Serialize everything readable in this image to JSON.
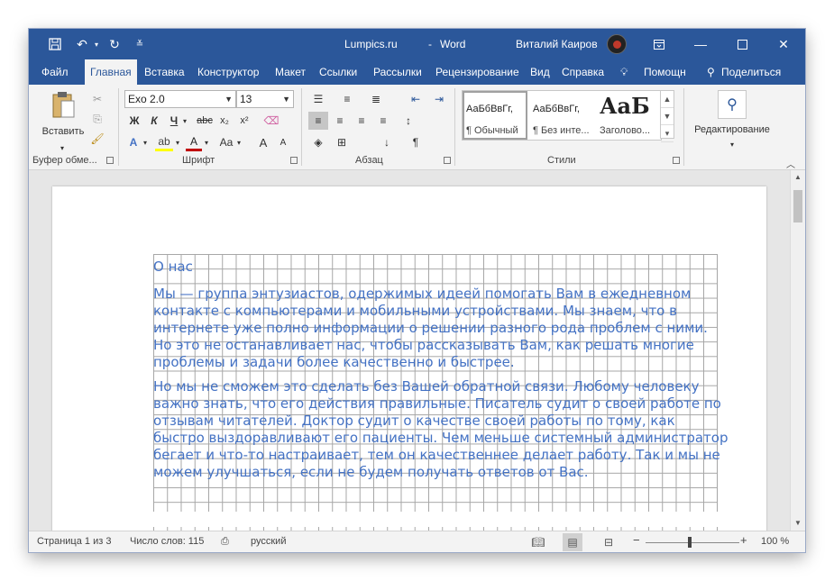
{
  "window": {
    "doc_title": "Lumpics.ru",
    "separator": "-",
    "app_name": "Word",
    "user_name": "Виталий Каиров"
  },
  "quick_access": {
    "save_icon": "save-icon",
    "undo_icon": "undo-icon",
    "redo_icon": "redo-icon",
    "customize_icon": "customize-icon"
  },
  "tabs": [
    "Файл",
    "Главная",
    "Вставка",
    "Конструктор",
    "Макет",
    "Ссылки",
    "Рассылки",
    "Рецензирование",
    "Вид",
    "Справка",
    "Помощн",
    "Поделиться"
  ],
  "active_tab": "Главная",
  "ribbon": {
    "clipboard": {
      "paste_label": "Вставить",
      "group_label": "Буфер обме..."
    },
    "font": {
      "font_name": "Exo 2.0",
      "font_size": "13",
      "group_label": "Шрифт",
      "bold": "Ж",
      "italic": "К",
      "underline": "Ч",
      "strike": "abc",
      "sub": "x₂",
      "sup": "x²",
      "case": "Aa",
      "grow": "A",
      "shrink": "A"
    },
    "paragraph": {
      "group_label": "Абзац"
    },
    "styles": {
      "group_label": "Стили",
      "items": [
        {
          "sample": "АаБбВвГг,",
          "name": "¶ Обычный"
        },
        {
          "sample": "АаБбВвГг,",
          "name": "¶ Без инте..."
        },
        {
          "sample": "АаБ",
          "name": "Заголово..."
        }
      ]
    },
    "editing": {
      "label": "Редактирование"
    }
  },
  "document": {
    "heading": "О нас",
    "paragraphs": [
      "Мы — группа энтузиастов, одержимых идеей помогать Вам в ежедневном контакте с компьютерами и мобильными устройствами. Мы знаем, что в интернете уже полно информации о решении разного рода проблем с ними. Но это не останавливает нас, чтобы рассказывать Вам, как решать многие проблемы и задачи более качественно и быстрее.",
      "Но мы не сможем это сделать без Вашей обратной связи. Любому человеку важно знать, что его действия правильные. Писатель судит о своей работе по отзывам читателей. Доктор судит о качестве своей работы по тому, как быстро выздоравливают его пациенты. Чем меньше системный администратор бегает и что-то настраивает, тем он качественнее делает работу. Так и мы не можем улучшаться, если не будем получать ответов от Вас."
    ],
    "text_color": "#4472c4"
  },
  "status": {
    "page": "Страница 1 из 3",
    "words": "Число слов: 115",
    "language": "русский",
    "minus": "−",
    "plus": "+",
    "zoom": "100 %",
    "zoom_fraction": 0.5
  },
  "colors": {
    "title_bar": "#2b579a",
    "ribbon": "#f3f3f3"
  }
}
